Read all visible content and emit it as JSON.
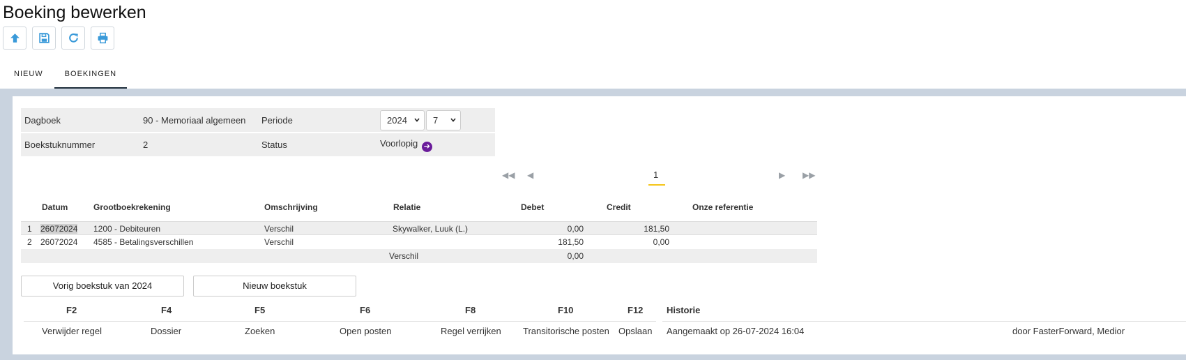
{
  "page": {
    "title": "Boeking bewerken"
  },
  "toolbar": [
    {
      "name": "up-arrow-icon"
    },
    {
      "name": "save-icon"
    },
    {
      "name": "refresh-icon"
    },
    {
      "name": "print-icon"
    }
  ],
  "tabs": [
    {
      "label": "NIEUW",
      "active": false
    },
    {
      "label": "BOEKINGEN",
      "active": true
    }
  ],
  "info": {
    "dagboek_label": "Dagboek",
    "dagboek_value": "90 - Memoriaal algemeen",
    "periode_label": "Periode",
    "periode_year": "2024",
    "periode_month": "7",
    "boekstuk_label": "Boekstuknummer",
    "boekstuk_value": "2",
    "status_label": "Status",
    "status_value": "Voorlopig"
  },
  "pager": {
    "current": "1"
  },
  "grid": {
    "headers": {
      "datum": "Datum",
      "grootboek": "Grootboekrekening",
      "omschrijving": "Omschrijving",
      "relatie": "Relatie",
      "debet": "Debet",
      "credit": "Credit",
      "referentie": "Onze referentie"
    },
    "rows": [
      {
        "nr": "1",
        "datum": "26072024",
        "grootboek": "1200 - Debiteuren",
        "omschrijving": "Verschil",
        "relatie": "Skywalker, Luuk (L.)",
        "debet": "0,00",
        "credit": "181,50"
      },
      {
        "nr": "2",
        "datum": "26072024",
        "grootboek": "4585 - Betalingsverschillen",
        "omschrijving": "Verschil",
        "relatie": "",
        "debet": "181,50",
        "credit": "0,00"
      }
    ],
    "total": {
      "label": "Verschil",
      "value": "0,00"
    }
  },
  "buttons": {
    "previous": "Vorig boekstuk van 2024",
    "new": "Nieuw boekstuk"
  },
  "fkeys": [
    {
      "key": "F2",
      "label": "Verwijder regel"
    },
    {
      "key": "F4",
      "label": "Dossier"
    },
    {
      "key": "F5",
      "label": "Zoeken"
    },
    {
      "key": "F6",
      "label": "Open posten"
    },
    {
      "key": "F8",
      "label": "Regel verrijken"
    },
    {
      "key": "F10",
      "label": "Transitorische posten"
    },
    {
      "key": "F12",
      "label": "Opslaan"
    }
  ],
  "historie": {
    "title": "Historie",
    "created": "Aangemaakt op 26-07-2024 16:04",
    "by": "door FasterForward, Medior"
  },
  "colors": {
    "accent": "#3a9ad9",
    "status_icon": "#6a1b9a",
    "pager_underline": "#f5c518",
    "panel_bg": "#c9d3df"
  }
}
